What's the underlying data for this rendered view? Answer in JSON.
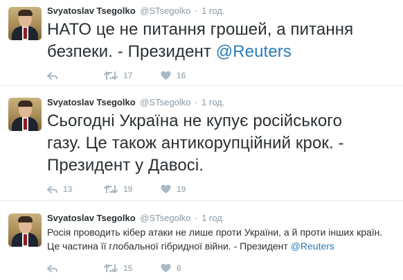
{
  "tweets": [
    {
      "author_name": "Svyatoslav Tsegolko",
      "handle": "@STsegolko",
      "separator": "·",
      "time": "1 год.",
      "text_main": "НАТО це не питання грошей, а питання безпеки. - Президент ",
      "mention": "@Reuters",
      "retweets": "17",
      "likes": "16",
      "replies": ""
    },
    {
      "author_name": "Svyatoslav Tsegolko",
      "handle": "@STsegolko",
      "separator": "·",
      "time": "1 год.",
      "text_main": "Сьогодні Україна не купує російського газу. Це також антикорупційний крок. - Президент у Давосі.",
      "mention": "",
      "replies": "13",
      "retweets": "19",
      "likes": "19"
    },
    {
      "author_name": "Svyatoslav Tsegolko",
      "handle": "@STsegolko",
      "separator": "·",
      "time": "1 год.",
      "text_main": "Росія проводить кібер атаки не лише проти України, а й проти інших країн. Це частина її глобальної гібридної війни. - Президент ",
      "mention": "@Reuters",
      "replies": "",
      "retweets": "15",
      "likes": "6"
    }
  ],
  "icons": {
    "reply": "reply-icon",
    "retweet": "retweet-icon",
    "like": "heart-icon"
  },
  "colors": {
    "mention": "#2b7bb9",
    "muted": "#8899a6",
    "action": "#aab8c2",
    "text": "#292f33"
  }
}
